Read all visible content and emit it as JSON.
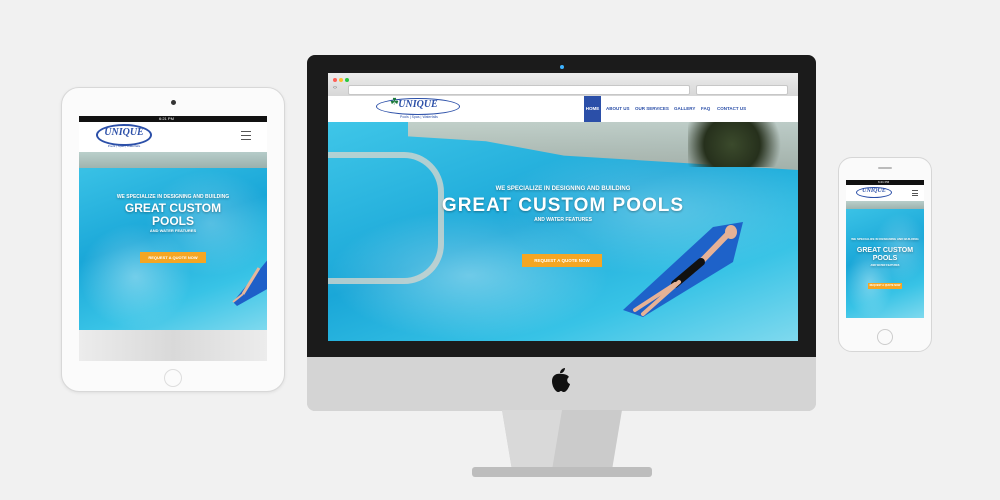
{
  "brand": {
    "logo_text": "UNIQUE",
    "tagline": "Pools | Spas | Waterfalls"
  },
  "status_time": "6:21 PM",
  "nav": {
    "items": [
      "HOME",
      "ABOUT US",
      "OUR SERVICES",
      "GALLERY",
      "FAQ",
      "CONTACT US"
    ],
    "active_index": 0
  },
  "hero": {
    "kicker": "WE SPECIALIZE IN DESIGNING AND BUILDING",
    "headline": "GREAT CUSTOM POOLS",
    "headline_line1": "GREAT CUSTOM",
    "headline_line2": "POOLS",
    "sub": "AND WATER FEATURES",
    "cta": "REQUEST A QUOTE NOW"
  },
  "icons": {
    "desktop_brand": "apple-icon",
    "menu": "hamburger-menu-icon"
  },
  "colors": {
    "accent": "#f5a623",
    "nav_active": "#2b4fa8",
    "water": "#1aa7d8",
    "device_dark": "#1a1a1a"
  }
}
